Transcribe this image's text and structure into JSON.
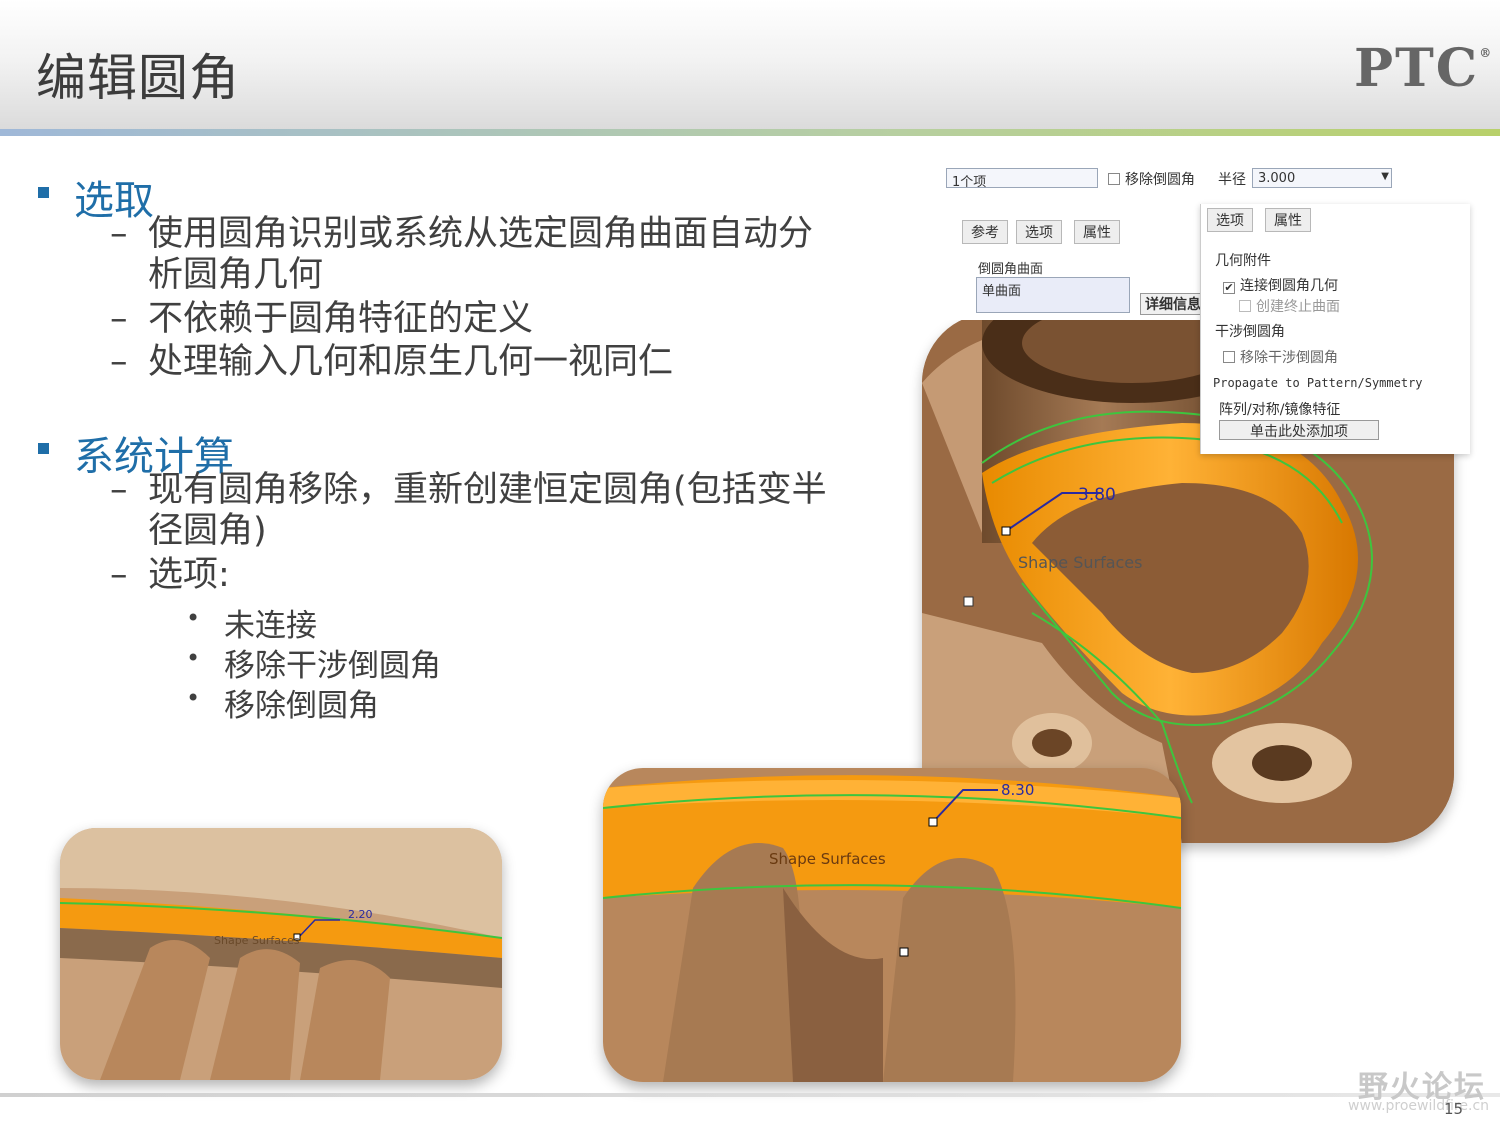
{
  "slide": {
    "title": "编辑圆角",
    "logo": "PTC",
    "logo_mark": "®",
    "page_number": "15"
  },
  "sections": [
    {
      "heading": "选取",
      "items": [
        {
          "line1": "使用圆角识别或系统从选定圆角曲面自动分",
          "line2": "析圆角几何"
        },
        {
          "line1": "不依赖于圆角特征的定义"
        },
        {
          "line1": "处理输入几何和原生几何一视同仁"
        }
      ]
    },
    {
      "heading": "系统计算",
      "items": [
        {
          "line1": "现有圆角移除，重新创建恒定圆角(包括变半",
          "line2": "径圆角)"
        },
        {
          "line1": "选项:"
        }
      ],
      "sub_items": [
        "未连接",
        "移除干涉倒圆角",
        "移除倒圆角"
      ]
    }
  ],
  "ui_dialog": {
    "selection_field": "1个项",
    "remove_round_label": "移除倒圆角",
    "radius_label": "半径",
    "radius_value": "3.000",
    "left_tabs": [
      "参考",
      "选项",
      "属性"
    ],
    "round_surface_label": "倒圆角曲面",
    "round_surface_value": "单曲面",
    "detail_button": "详细信息",
    "right_tabs": [
      "选项",
      "属性"
    ],
    "geometry_group": "几何附件",
    "connect_geometry": "连接倒圆角几何",
    "create_stop_surface": "创建终止曲面",
    "interference_group": "干涉倒圆角",
    "remove_interference": "移除干涉倒圆角",
    "propagate_label": "Propagate to Pattern/Symmetry",
    "pattern_label": "阵列/对称/镜像特征",
    "add_button": "单击此处添加项"
  },
  "cad_annotations": {
    "main_dim": "3.80",
    "main_label": "Shape Surfaces",
    "left_dim": "2.20",
    "left_label": "Shape Surfaces",
    "mid_dim": "8.30",
    "mid_label": "Shape Surfaces"
  },
  "watermark": {
    "text": "野火论坛",
    "url": "www.proewildfire.cn"
  },
  "colors": {
    "accent_blue": "#1f6ea8",
    "fillet_orange": "#f59a10",
    "part_tan": "#c9a07a",
    "edge_green": "#3ec53e",
    "dim_blue": "#2a2aa0"
  }
}
